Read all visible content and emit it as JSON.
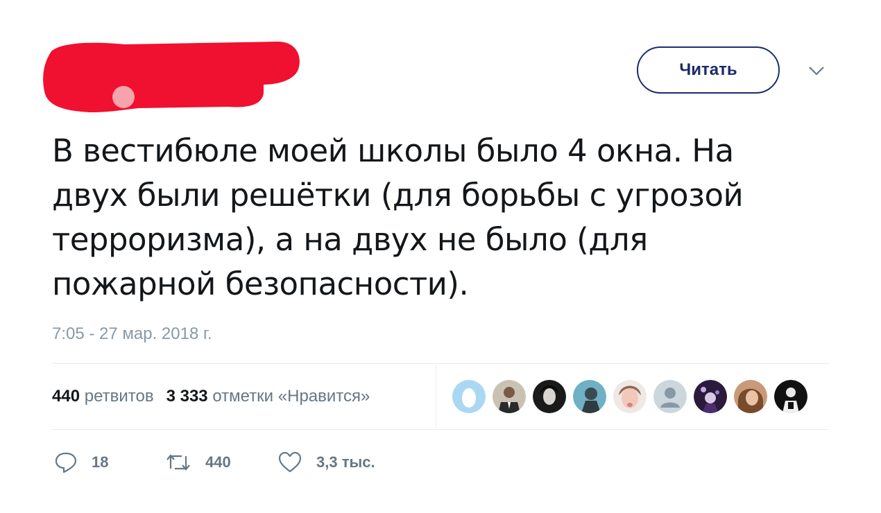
{
  "header": {
    "follow_label": "Читать",
    "menu_icon": "chevron-down-icon"
  },
  "tweet": {
    "text_lines": [
      "В вестибюле моей школы было 4 окна. На",
      "двух были решётки (для борьбы с угрозой",
      "терроризма), а на двух не было (для",
      "пожарной безопасности)."
    ],
    "timestamp": "7:05 - 27 мар. 2018 г."
  },
  "stats": {
    "retweets_count": "440",
    "retweets_label": "ретвитов",
    "likes_count": "3 333",
    "likes_label": "отметки «Нравится»"
  },
  "liker_avatars": [
    "egg-avatar",
    "avatar-suit",
    "avatar-dark-hair",
    "avatar-blue",
    "avatar-face",
    "avatar-default",
    "avatar-purple",
    "avatar-brown",
    "avatar-black-white"
  ],
  "actions": {
    "reply_count": "18",
    "retweet_count": "440",
    "like_count": "3,3 тыс."
  },
  "colors": {
    "redaction": "#f0102f",
    "follow_border": "#1c2b6b",
    "muted_text": "#657786",
    "timestamp": "#8899a6",
    "divider": "#e6ecf0"
  }
}
